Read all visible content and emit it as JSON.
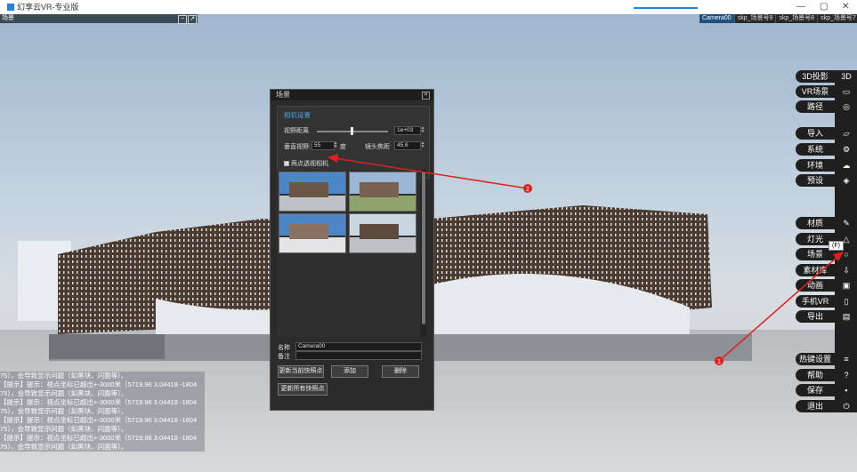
{
  "window": {
    "title": "幻享云VR-专业版",
    "minimize": "—",
    "maximize": "▢",
    "close": "✕"
  },
  "top_left_panel": {
    "label": "场景"
  },
  "scene_tabs": [
    {
      "label": "Camera00",
      "active": true
    },
    {
      "label": "skp_场景号9",
      "active": false
    },
    {
      "label": "skp_场景号8",
      "active": false
    },
    {
      "label": "skp_场景号7",
      "active": false
    },
    {
      "label": "+",
      "active": false
    }
  ],
  "right_menu": {
    "items": [
      {
        "label": "3D投影",
        "icon": "3D"
      },
      {
        "label": "VR场景",
        "icon": "vr-headset-icon"
      },
      {
        "label": "路径",
        "icon": "path-icon"
      },
      {
        "label": "导入",
        "icon": "folder-icon"
      },
      {
        "label": "系统",
        "icon": "gear-icon"
      },
      {
        "label": "环境",
        "icon": "weather-icon"
      },
      {
        "label": "预设",
        "icon": "layers-icon"
      },
      {
        "label": "材质",
        "icon": "edit-icon"
      },
      {
        "label": "灯光",
        "icon": "light-icon"
      },
      {
        "label": "场景",
        "icon": "scene-icon"
      },
      {
        "label": "素材库",
        "icon": "download-icon"
      },
      {
        "label": "动画",
        "icon": "camera-icon"
      },
      {
        "label": "手机VR",
        "icon": "phone-icon"
      },
      {
        "label": "导出",
        "icon": "export-icon"
      },
      {
        "label": "热键设置",
        "icon": "list-icon"
      },
      {
        "label": "帮助",
        "icon": "help-icon"
      },
      {
        "label": "保存",
        "icon": "save-icon"
      },
      {
        "label": "退出",
        "icon": "power-icon"
      }
    ],
    "tooltip": "(F)"
  },
  "log": {
    "lines": [
      "75），会导致显示问题（如黑块、闪面等）。",
      "【提示】提示：视点坐标已超出+-3000米（5719.96 3.04418 -1804",
      "75），会导致显示问题（如黑块、闪面等）。",
      "【提示】提示：视点坐标已超出+-3000米（5719.96 3.04418 -1804",
      "75），会导致显示问题（如黑块、闪面等）。",
      "【提示】提示：视点坐标已超出+-3000米（5719.96 3.04418 -1804",
      "75），会导致显示问题（如黑块、闪面等）。",
      "【提示】提示：视点坐标已超出+-3000米（5719.96 3.04418 -1804",
      "75），会导致显示问题（如黑块、闪面等）。"
    ]
  },
  "dialog": {
    "title": "场景",
    "section_title": "相机设置",
    "view_distance_label": "视野距离",
    "view_distance_value": "1e+03",
    "vertical_fov_label": "垂直视野:",
    "vertical_fov_value": "55",
    "fov_unit": "度",
    "focal_label": "镜头焦距",
    "focal_value": "45.6",
    "two_point_label": "两点透视相机",
    "name_label": "名称",
    "name_value": "Camera00",
    "note_label": "备注",
    "note_value": "",
    "update_current_button": "更新当前快照点",
    "add_button": "添加",
    "delete_button": "删除",
    "update_all_button": "更新所有快照点"
  },
  "annotations": [
    {
      "label": "1"
    },
    {
      "label": "2"
    }
  ],
  "colors": {
    "accent": "#4aa3df",
    "arrow": "#e02020",
    "panel_bg": "#2b2b2b",
    "menu_bg": "#1f1f1f"
  }
}
